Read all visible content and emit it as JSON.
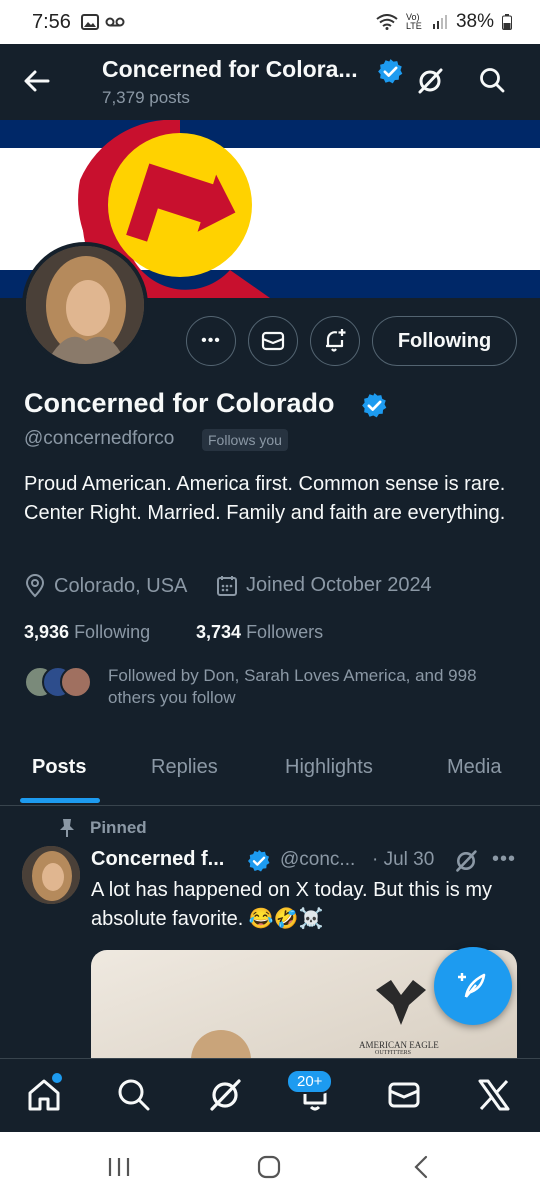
{
  "status_bar": {
    "time": "7:56",
    "battery": "38%",
    "network_label": "Vo) LTE"
  },
  "header": {
    "title": "Concerned for Colora...",
    "post_count": "7,379 posts"
  },
  "profile": {
    "name": "Concerned for Colorado",
    "handle": "@concernedforco",
    "follows_you": "Follows you",
    "bio": "Proud American. America first. Common sense is rare. Center Right. Married. Family and faith are everything.",
    "location": "Colorado, USA",
    "joined": "Joined October 2024",
    "following_count": "3,936",
    "following_label": "Following",
    "followers_count": "3,734",
    "followers_label": "Followers",
    "followed_by": "Followed by Don, Sarah Loves America, and 998 others you follow",
    "following_button": "Following",
    "more_button": "•••"
  },
  "tabs": [
    {
      "label": "Posts"
    },
    {
      "label": "Replies"
    },
    {
      "label": "Highlights"
    },
    {
      "label": "Media"
    }
  ],
  "post": {
    "pinned_label": "Pinned",
    "author": "Concerned f...",
    "handle": "@conc...",
    "date": "· Jul 30",
    "more": "•••",
    "text": "A lot has happened on X today. But this is my absolute favorite. 😂🤣☠️",
    "media_brand": "AMERICAN EAGLE",
    "media_brand_sub": "OUTFITTERS"
  },
  "bottom_nav": {
    "notification_badge": "20+"
  },
  "colors": {
    "background": "#15202b",
    "accent": "#1d9bf0",
    "muted": "#8b98a5",
    "text": "#f7f9f9"
  },
  "icons": [
    "back-arrow-icon",
    "verified-icon",
    "grok-icon",
    "search-icon",
    "more-icon",
    "mail-icon",
    "bell-plus-icon",
    "location-icon",
    "calendar-icon",
    "pin-icon",
    "compose-icon",
    "home-icon",
    "bell-icon",
    "x-logo-icon"
  ]
}
